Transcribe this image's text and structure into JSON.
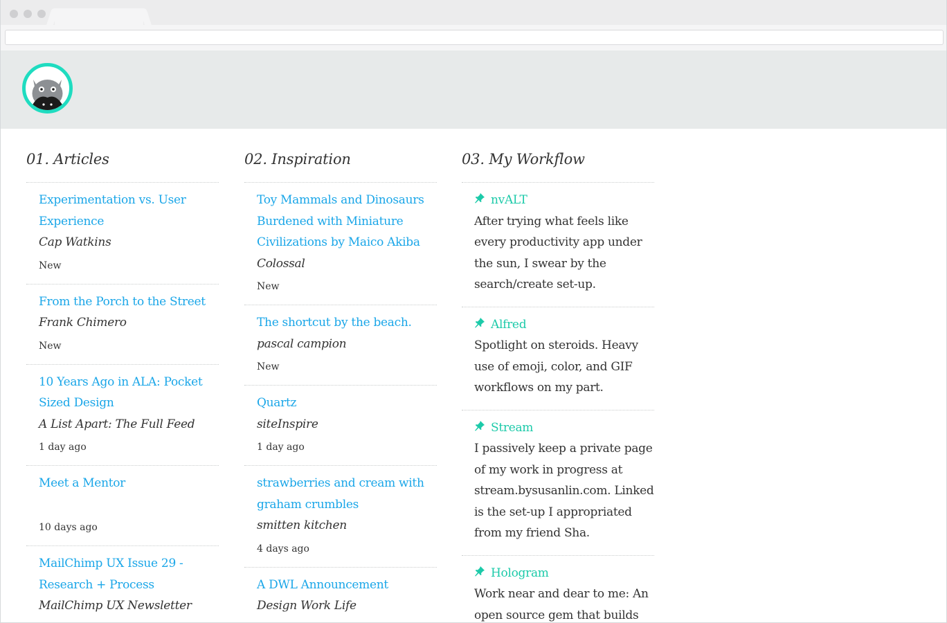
{
  "colors": {
    "link": "#1aa6e8",
    "workflow_link": "#1ccaa9",
    "header_bg": "#e7eaea",
    "avatar_ring": "#1fdcc0"
  },
  "columns": [
    {
      "title": "01. Articles",
      "items": [
        {
          "title": "Experimentation vs. User Experience",
          "source": "Cap Watkins",
          "time": "New"
        },
        {
          "title": "From the Porch to the Street",
          "source": "Frank Chimero",
          "time": "New"
        },
        {
          "title": "10 Years Ago in ALA: Pocket Sized Design",
          "source": "A List Apart: The Full Feed",
          "time": "1 day ago"
        },
        {
          "title": "Meet a Mentor",
          "source": "",
          "time": "10 days ago"
        },
        {
          "title": "MailChimp UX Issue 29 - Research + Process",
          "source": "MailChimp UX Newsletter",
          "time": ""
        }
      ]
    },
    {
      "title": "02. Inspiration",
      "items": [
        {
          "title": "Toy Mammals and Dinosaurs Burdened with Miniature Civilizations by Maico Akiba",
          "source": "Colossal",
          "time": "New"
        },
        {
          "title": "The shortcut by the beach.",
          "source": "pascal campion",
          "time": "New"
        },
        {
          "title": "Quartz",
          "source": "siteInspire",
          "time": "1 day ago"
        },
        {
          "title": "strawberries and cream with graham crumbles",
          "source": "smitten kitchen",
          "time": "4 days ago"
        },
        {
          "title": "A DWL Announcement",
          "source": "Design Work Life",
          "time": ""
        }
      ]
    },
    {
      "title": "03. My Workflow",
      "items": [
        {
          "title": "nvALT",
          "icon": "pin-icon",
          "desc": "After trying what feels like every productivity app under the sun, I swear by the search/create set-up."
        },
        {
          "title": "Alfred",
          "icon": "pin-icon",
          "desc": "Spotlight on steroids. Heavy use of emoji, color, and GIF workflows on my part."
        },
        {
          "title": "Stream",
          "icon": "pin-icon",
          "desc": "I passively keep a private page of my work in progress at stream.bysusanlin.com. Linked is the set-up I appropriated from my friend Sha."
        },
        {
          "title": "Hologram",
          "icon": "pin-icon",
          "desc": "Work near and dear to me: An open source gem that builds"
        }
      ]
    }
  ]
}
